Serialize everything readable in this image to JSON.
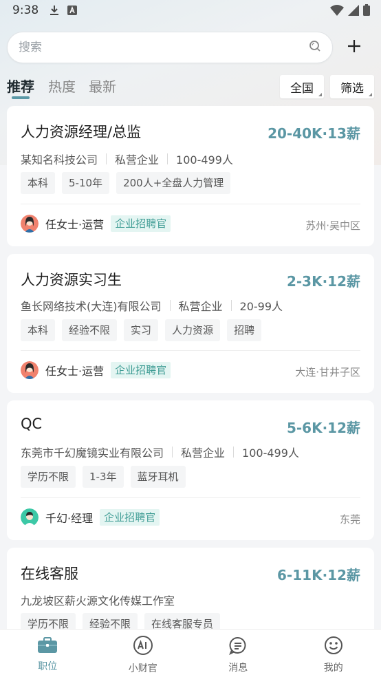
{
  "status_bar": {
    "time": "9:38",
    "icons": [
      "download-icon",
      "a-notification-icon",
      "wifi-icon",
      "signal-icon",
      "battery-icon"
    ]
  },
  "search": {
    "placeholder": "搜索"
  },
  "tabs": [
    {
      "label": "推荐",
      "active": true
    },
    {
      "label": "热度",
      "active": false
    },
    {
      "label": "最新",
      "active": false
    }
  ],
  "filters": {
    "region_label": "全国",
    "filter_label": "筛选"
  },
  "colors": {
    "accent": "#5b97a4",
    "badge_text": "#3e9c94",
    "badge_bg": "#e4f5f2"
  },
  "jobs": [
    {
      "title": "人力资源经理/总监",
      "salary": "20-40K·13薪",
      "company": "某知名科技公司",
      "company_type": "私营企业",
      "company_size": "100-499人",
      "tags": [
        "本科",
        "5-10年",
        "200人+全盘人力管理"
      ],
      "recruiter": "任女士·运营",
      "badge": "企业招聘官",
      "location": "苏州·吴中区",
      "avatar": "female-avatar"
    },
    {
      "title": "人力资源实习生",
      "salary": "2-3K·12薪",
      "company": "鱼长网络技术(大连)有限公司",
      "company_type": "私营企业",
      "company_size": "20-99人",
      "tags": [
        "本科",
        "经验不限",
        "实习",
        "人力资源",
        "招聘"
      ],
      "recruiter": "任女士·运营",
      "badge": "企业招聘官",
      "location": "大连·甘井子区",
      "avatar": "female-avatar"
    },
    {
      "title": "QC",
      "salary": "5-6K·12薪",
      "company": "东莞市千幻魔镜实业有限公司",
      "company_type": "私营企业",
      "company_size": "100-499人",
      "tags": [
        "学历不限",
        "1-3年",
        "蓝牙耳机"
      ],
      "recruiter": "千幻·经理",
      "badge": "企业招聘官",
      "location": "东莞",
      "avatar": "male-avatar"
    },
    {
      "title": "在线客服",
      "salary": "6-11K·12薪",
      "company": "九龙坡区薪火源文化传媒工作室",
      "tags": [
        "学历不限",
        "经验不限",
        "在线客服专员"
      ]
    }
  ],
  "bottom_nav": [
    {
      "label": "职位",
      "icon": "briefcase-icon",
      "active": true
    },
    {
      "label": "小财官",
      "icon": "ai-icon",
      "active": false
    },
    {
      "label": "消息",
      "icon": "message-icon",
      "active": false
    },
    {
      "label": "我的",
      "icon": "smile-icon",
      "active": false
    }
  ]
}
